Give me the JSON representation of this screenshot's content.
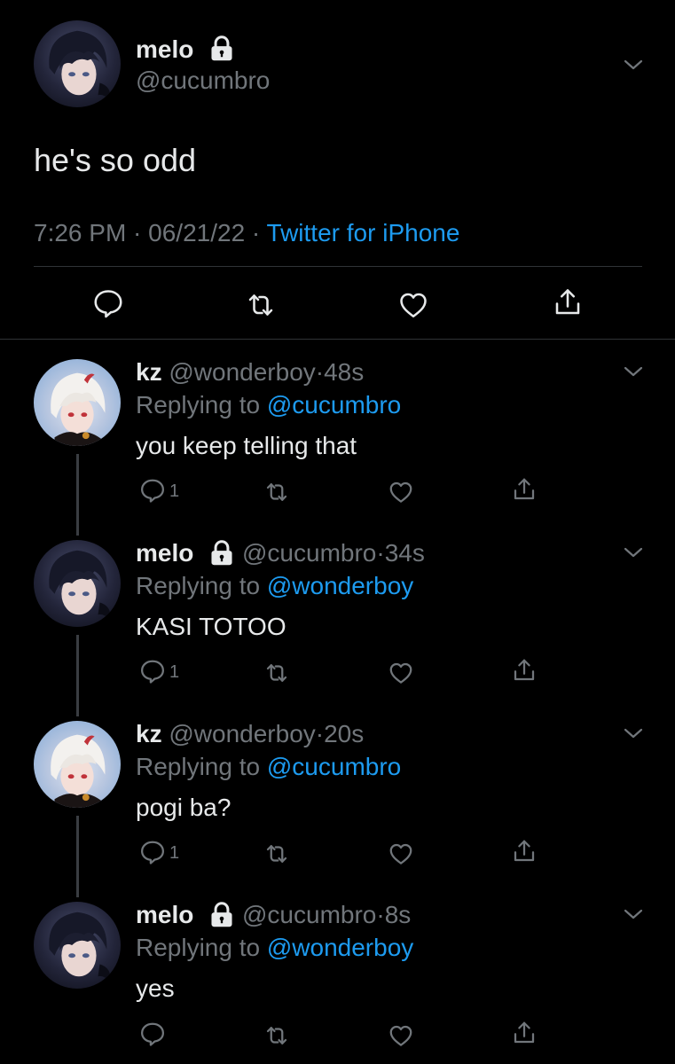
{
  "main_tweet": {
    "display_name": "melo",
    "handle": "@cucumbro",
    "text": "he's so odd",
    "time": "7:26 PM · 06/21/22 · ",
    "source": "Twitter for iPhone",
    "avatar_icon": "anime-boy-avatar",
    "locked_icon": "lock-icon"
  },
  "replies": [
    {
      "display_name": "kz",
      "handle": "@wonderboy",
      "age": "48s",
      "replying_prefix": "Replying to ",
      "replying_to": "@cucumbro",
      "text": "you keep telling that",
      "reply_count": "1",
      "locked": false
    },
    {
      "display_name": "melo",
      "handle": "@cucumbro",
      "age": "34s",
      "replying_prefix": "Replying to ",
      "replying_to": "@wonderboy",
      "text": "KASI TOTOO",
      "reply_count": "1",
      "locked": true
    },
    {
      "display_name": "kz",
      "handle": "@wonderboy",
      "age": "20s",
      "replying_prefix": "Replying to ",
      "replying_to": "@cucumbro",
      "text": "pogi ba?",
      "reply_count": "1",
      "locked": false
    },
    {
      "display_name": "melo",
      "handle": "@cucumbro",
      "age": "8s",
      "replying_prefix": "Replying to ",
      "replying_to": "@wonderboy",
      "text": "yes",
      "reply_count": "",
      "locked": true
    }
  ],
  "separators": {
    "dot": "·"
  },
  "colors": {
    "background": "#000000",
    "text": "#e7e9ea",
    "muted": "#71767b",
    "link": "#1d9bf0"
  }
}
